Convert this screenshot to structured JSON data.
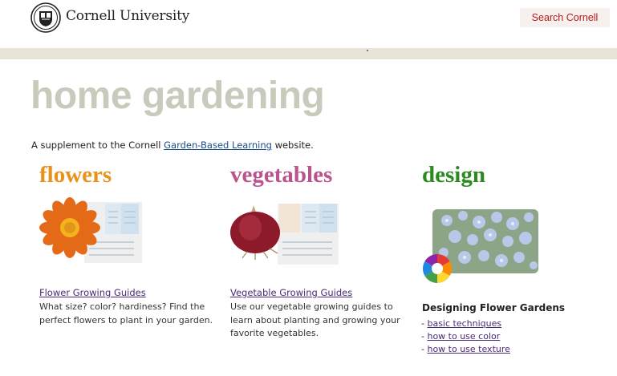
{
  "header": {
    "brand": "Cornell University",
    "search_label": "Search Cornell"
  },
  "main": {
    "title": "home gardening",
    "intro_prefix": "A supplement to the Cornell ",
    "intro_link": "Garden-Based Learning",
    "intro_suffix": " website."
  },
  "columns": [
    {
      "title": "flowers",
      "link": "Flower Growing Guides",
      "description": "What size? color? hardiness? Find the perfect flowers to plant in your garden."
    },
    {
      "title": "vegetables",
      "link": "Vegetable Growing Guides",
      "description": "Use our vegetable growing guides to learn about planting and growing your favorite vegetables."
    },
    {
      "title": "design",
      "heading": "Designing Flower Gardens",
      "links": [
        "basic techniques",
        "how to use color",
        "how to use texture"
      ]
    }
  ],
  "colors": {
    "flowers": "#e8921c",
    "vegetables": "#b9548c",
    "design": "#2b8b1f",
    "brand_red": "#b31b1b"
  }
}
